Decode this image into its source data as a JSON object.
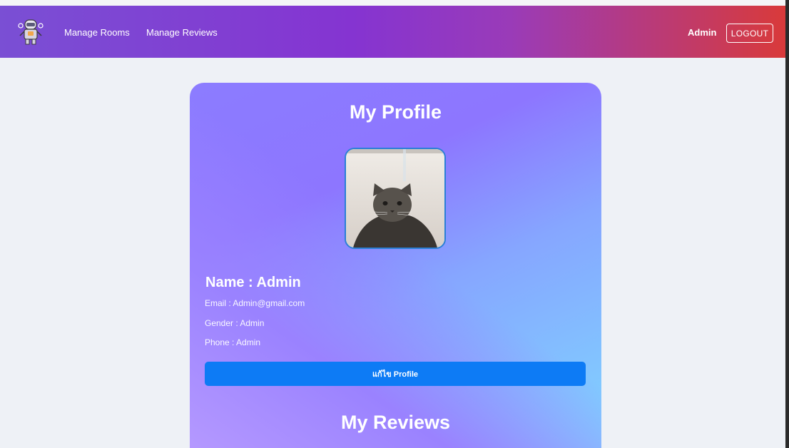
{
  "navbar": {
    "links": [
      "Manage Rooms",
      "Manage Reviews"
    ],
    "user_name": "Admin",
    "logout_label": "LOGOUT",
    "gradient_colors": [
      "#7a4fd4",
      "#8534d1",
      "#c53a60",
      "#d93a3a"
    ]
  },
  "profile": {
    "title": "My Profile",
    "name": "Name : Admin",
    "email": "Email : Admin@gmail.com",
    "gender": "Gender : Admin",
    "phone": "Phone : Admin",
    "edit_label": "แก้ไข Profile",
    "button_color": "#0d7bf5"
  },
  "reviews": {
    "title": "My Reviews"
  }
}
